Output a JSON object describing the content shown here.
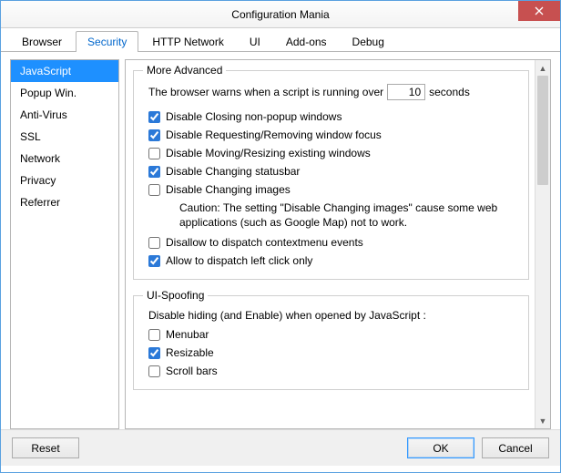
{
  "window": {
    "title": "Configuration Mania"
  },
  "tabs": [
    "Browser",
    "Security",
    "HTTP Network",
    "UI",
    "Add-ons",
    "Debug"
  ],
  "active_tab_index": 1,
  "sidebar": {
    "items": [
      "JavaScript",
      "Popup Win.",
      "Anti-Virus",
      "SSL",
      "Network",
      "Privacy",
      "Referrer"
    ],
    "selected_index": 0
  },
  "more_advanced": {
    "legend": "More Advanced",
    "warn_prefix": "The browser warns when a script is running over",
    "warn_value": "10",
    "warn_suffix": "seconds",
    "options": [
      {
        "label": "Disable Closing non-popup windows",
        "checked": true
      },
      {
        "label": "Disable Requesting/Removing window focus",
        "checked": true
      },
      {
        "label": "Disable Moving/Resizing existing windows",
        "checked": false
      },
      {
        "label": "Disable Changing statusbar",
        "checked": true
      },
      {
        "label": "Disable Changing images",
        "checked": false
      }
    ],
    "caution": "Caution: The setting \"Disable Changing images\" cause some web applications (such as Google Map) not to work.",
    "options2": [
      {
        "label": "Disallow to dispatch contextmenu events",
        "checked": false
      },
      {
        "label": "Allow to dispatch left click only",
        "checked": true
      }
    ]
  },
  "ui_spoofing": {
    "legend": "UI-Spoofing",
    "subhead": "Disable hiding (and Enable) when opened by JavaScript :",
    "options": [
      {
        "label": "Menubar",
        "checked": false
      },
      {
        "label": "Resizable",
        "checked": true
      },
      {
        "label": "Scroll bars",
        "checked": false
      }
    ]
  },
  "footer": {
    "reset": "Reset",
    "ok": "OK",
    "cancel": "Cancel"
  }
}
